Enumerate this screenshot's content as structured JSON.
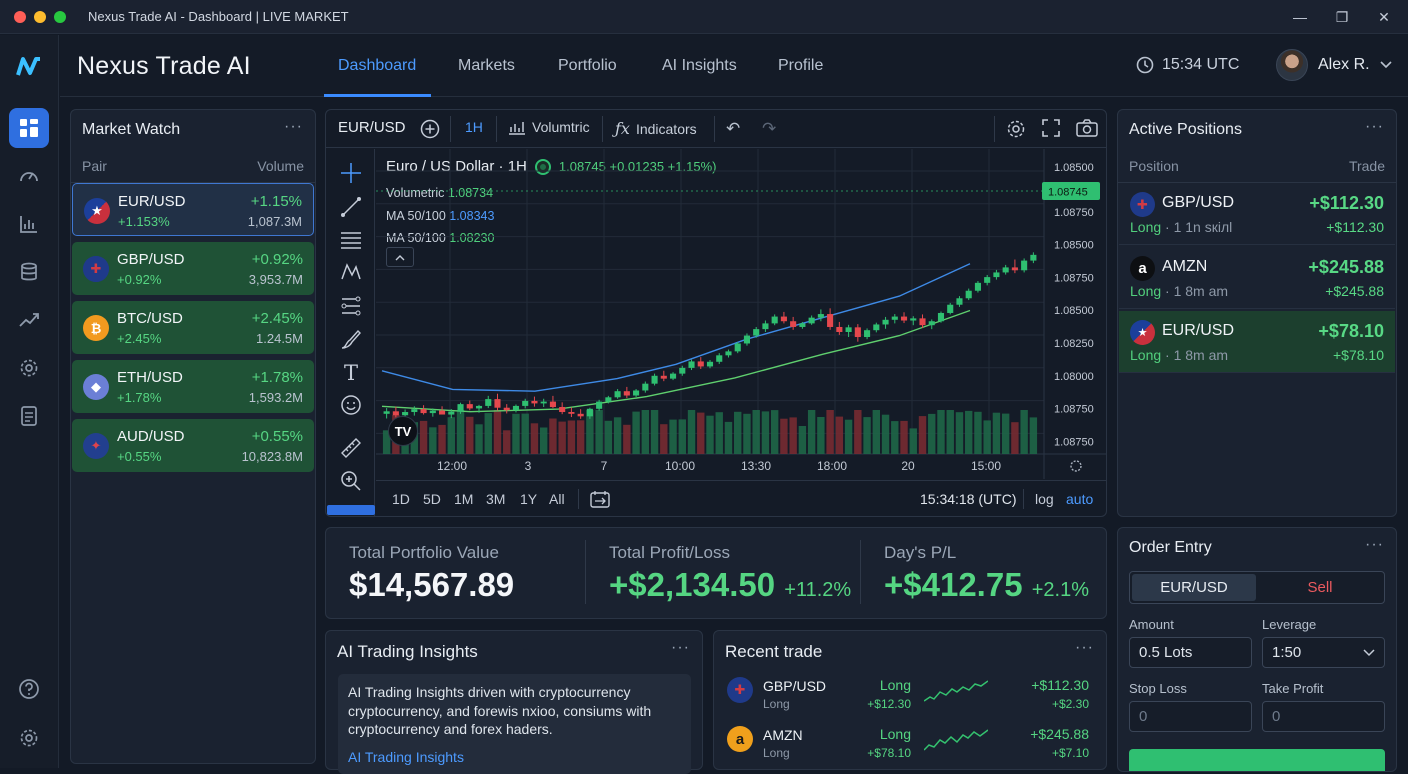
{
  "window": {
    "title": "Nexus Trade AI - Dashboard | LIVE MARKET",
    "minimize": "—",
    "maximize": "❐",
    "close": "✕"
  },
  "brand": {
    "name": "Nexus Trade AI"
  },
  "nav": {
    "tabs": [
      "Dashboard",
      "Markets",
      "Portfolio",
      "AI Insights",
      "Profile"
    ],
    "active": "Dashboard"
  },
  "header": {
    "time": "15:34 UTC",
    "user_name": "Alex R."
  },
  "sidebar_icons": [
    "dashboard-icon",
    "gauge-icon",
    "chart-bars-icon",
    "database-icon",
    "trend-up-icon",
    "gear-icon",
    "report-icon",
    "help-icon",
    "settings-icon"
  ],
  "market_watch": {
    "title": "Market Watch",
    "menu": "···",
    "col_pair": "Pair",
    "col_volume": "Volume",
    "items": [
      {
        "pair": "EUR/USD",
        "sub": "+1.153%",
        "change": "+1.15%",
        "volume": "1,087.3M",
        "icon": "us-eu-flag"
      },
      {
        "pair": "GBP/USD",
        "sub": "+0.92%",
        "change": "+0.92%",
        "volume": "3,953.7M",
        "icon": "uk-flag"
      },
      {
        "pair": "BTC/USD",
        "sub": "+2.45%",
        "change": "+2.45%",
        "volume": "1.24.5M",
        "icon": "bitcoin-icon"
      },
      {
        "pair": "ETH/USD",
        "sub": "+1.78%",
        "change": "+1.78%",
        "volume": "1,593.2M",
        "icon": "ethereum-icon"
      },
      {
        "pair": "AUD/USD",
        "sub": "+0.55%",
        "change": "+0.55%",
        "volume": "10,823.8M",
        "icon": "australia-flag"
      }
    ]
  },
  "chart_toolbar": {
    "symbol": "EUR/USD",
    "interval": "1H",
    "volumetric": "Volumtric",
    "indicators": "Indicators"
  },
  "chart_legend": {
    "title": "Euro / US Dollar · 1H",
    "quote": "1.08745 +0.01235 +1.15%)",
    "volumetric_label": "Volumetric",
    "volumetric_value": "1.08734",
    "ma1_label": "MA 50/100",
    "ma1_value": "1.08343",
    "ma2_label": "MA 50/100",
    "ma2_value": "1.08230"
  },
  "chart_footer": {
    "ranges": [
      "1D",
      "5D",
      "1M",
      "3M",
      "1Y",
      "All"
    ],
    "clock": "15:34:18 (UTC)",
    "log": "log",
    "auto": "auto"
  },
  "chart_data": {
    "type": "candlestick",
    "title": "Euro / US Dollar · 1H",
    "x_ticks": [
      "12:00",
      "3",
      "7",
      "10:00",
      "13:30",
      "18:00",
      "20",
      "15:00"
    ],
    "y_ticks": [
      "1.08500",
      "1.08750",
      "1.08500",
      "1.08750",
      "1.08500",
      "1.08250",
      "1.08000",
      "1.08750",
      "1.08750"
    ],
    "last_price": "1.08745",
    "ylim": [
      1.0795,
      1.088
    ],
    "grid": true,
    "candles": [
      [
        1.08062,
        1.08078,
        1.08049,
        1.08069
      ],
      [
        1.08069,
        1.08082,
        1.08052,
        1.08058
      ],
      [
        1.08058,
        1.08074,
        1.08046,
        1.08067
      ],
      [
        1.08067,
        1.08083,
        1.08057,
        1.08075
      ],
      [
        1.08075,
        1.08086,
        1.0806,
        1.08064
      ],
      [
        1.08064,
        1.08077,
        1.08054,
        1.08071
      ],
      [
        1.08071,
        1.08083,
        1.08061,
        1.0806
      ],
      [
        1.0806,
        1.08075,
        1.0805,
        1.08068
      ],
      [
        1.08068,
        1.08093,
        1.08062,
        1.08089
      ],
      [
        1.08089,
        1.08099,
        1.08072,
        1.08077
      ],
      [
        1.08077,
        1.08087,
        1.08065,
        1.08084
      ],
      [
        1.08084,
        1.08112,
        1.08078,
        1.08103
      ],
      [
        1.08103,
        1.08118,
        1.08071,
        1.08079
      ],
      [
        1.08079,
        1.08089,
        1.08063,
        1.08072
      ],
      [
        1.08072,
        1.08088,
        1.08066,
        1.08084
      ],
      [
        1.08084,
        1.08104,
        1.08077,
        1.08098
      ],
      [
        1.08098,
        1.0811,
        1.08082,
        1.08091
      ],
      [
        1.08091,
        1.08104,
        1.08081,
        1.08096
      ],
      [
        1.08096,
        1.08112,
        1.08078,
        1.08081
      ],
      [
        1.08081,
        1.08094,
        1.08061,
        1.08067
      ],
      [
        1.08067,
        1.0808,
        1.08053,
        1.08062
      ],
      [
        1.08062,
        1.08075,
        1.08048,
        1.08055
      ],
      [
        1.08055,
        1.08079,
        1.08048,
        1.08076
      ],
      [
        1.08076,
        1.08101,
        1.08071,
        1.08096
      ],
      [
        1.08096,
        1.08112,
        1.08091,
        1.08108
      ],
      [
        1.08108,
        1.08131,
        1.08104,
        1.08125
      ],
      [
        1.08125,
        1.08137,
        1.08106,
        1.08113
      ],
      [
        1.08113,
        1.08131,
        1.08109,
        1.08127
      ],
      [
        1.08127,
        1.08152,
        1.08121,
        1.08146
      ],
      [
        1.08146,
        1.08174,
        1.08141,
        1.08168
      ],
      [
        1.08168,
        1.08182,
        1.08153,
        1.0816
      ],
      [
        1.0816,
        1.08178,
        1.08156,
        1.08174
      ],
      [
        1.08174,
        1.08196,
        1.08168,
        1.0819
      ],
      [
        1.0819,
        1.08213,
        1.08184,
        1.08208
      ],
      [
        1.08208,
        1.0822,
        1.08187,
        1.08194
      ],
      [
        1.08194,
        1.08212,
        1.08189,
        1.08207
      ],
      [
        1.08207,
        1.08231,
        1.08201,
        1.08225
      ],
      [
        1.08225,
        1.08241,
        1.08219,
        1.08236
      ],
      [
        1.08236,
        1.08262,
        1.08231,
        1.08258
      ],
      [
        1.08258,
        1.08286,
        1.08252,
        1.0828
      ],
      [
        1.0828,
        1.08304,
        1.08274,
        1.08298
      ],
      [
        1.08298,
        1.08322,
        1.0829,
        1.08314
      ],
      [
        1.08314,
        1.08339,
        1.08309,
        1.08333
      ],
      [
        1.08333,
        1.08346,
        1.08314,
        1.0832
      ],
      [
        1.0832,
        1.08332,
        1.08296,
        1.08304
      ],
      [
        1.08304,
        1.08318,
        1.08299,
        1.08314
      ],
      [
        1.08314,
        1.08336,
        1.0831,
        1.0833
      ],
      [
        1.0833,
        1.08353,
        1.0832,
        1.0834
      ],
      [
        1.0834,
        1.08356,
        1.08296,
        1.08304
      ],
      [
        1.08304,
        1.08318,
        1.08282,
        1.0829
      ],
      [
        1.0829,
        1.0831,
        1.08276,
        1.08303
      ],
      [
        1.08303,
        1.08312,
        1.08263,
        1.08276
      ],
      [
        1.08276,
        1.083,
        1.0827,
        1.08295
      ],
      [
        1.08295,
        1.08316,
        1.08289,
        1.08311
      ],
      [
        1.08311,
        1.08332,
        1.08299,
        1.08324
      ],
      [
        1.08324,
        1.0834,
        1.08314,
        1.08333
      ],
      [
        1.08333,
        1.08345,
        1.08315,
        1.08322
      ],
      [
        1.08322,
        1.08334,
        1.08309,
        1.08328
      ],
      [
        1.08328,
        1.08339,
        1.08301,
        1.08309
      ],
      [
        1.08309,
        1.08325,
        1.08298,
        1.0832
      ],
      [
        1.0832,
        1.08347,
        1.08316,
        1.08343
      ],
      [
        1.08343,
        1.08371,
        1.08339,
        1.08366
      ],
      [
        1.08366,
        1.0839,
        1.0836,
        1.08384
      ],
      [
        1.08384,
        1.08411,
        1.08379,
        1.08405
      ],
      [
        1.08405,
        1.08432,
        1.084,
        1.08427
      ],
      [
        1.08427,
        1.08449,
        1.0842,
        1.08443
      ],
      [
        1.08443,
        1.08463,
        1.08436,
        1.08456
      ],
      [
        1.08456,
        1.08477,
        1.0845,
        1.0847
      ],
      [
        1.0847,
        1.08492,
        1.08454,
        1.08462
      ],
      [
        1.08462,
        1.08495,
        1.08456,
        1.08489
      ],
      [
        1.08489,
        1.08512,
        1.08482,
        1.08505
      ]
    ],
    "ma_fast": [
      [
        0,
        1.08182
      ],
      [
        0.12,
        1.0813
      ],
      [
        0.26,
        1.08125
      ],
      [
        0.4,
        1.0816
      ],
      [
        0.5,
        1.082
      ],
      [
        0.62,
        1.0827
      ],
      [
        0.75,
        1.0833
      ],
      [
        0.88,
        1.0839
      ],
      [
        1,
        1.0848
      ]
    ],
    "ma_slow": [
      [
        0,
        1.08083
      ],
      [
        0.15,
        1.08068
      ],
      [
        0.3,
        1.08075
      ],
      [
        0.45,
        1.0811
      ],
      [
        0.6,
        1.08162
      ],
      [
        0.75,
        1.08228
      ],
      [
        0.88,
        1.0828
      ],
      [
        1,
        1.0835
      ]
    ]
  },
  "stats": {
    "total_label": "Total Portfolio Value",
    "total_value": "$14,567.89",
    "pl_label": "Total Profit/Loss",
    "pl_value": "+$2,134.50",
    "pl_pct": "+11.2%",
    "day_label": "Day's P/L",
    "day_value": "+$412.75",
    "day_pct": "+2.1%"
  },
  "ai_insights": {
    "title": "AI Trading Insights",
    "menu": "···",
    "body": "AI Trading Insights driven with cryptocurrency cryptocurrency, and forewis nxioo, consiums with cryptocurrency and forex haders.",
    "link": "AI Trading Insights"
  },
  "recent_trade": {
    "title": "Recent trade",
    "menu": "···",
    "rows": [
      {
        "pair": "GBP/USD",
        "sub": "Long",
        "dir": "Long",
        "dir_val": "+$12.30",
        "pnl": "+$112.30",
        "pnl_sub": "+$2.30",
        "icon": "uk-flag"
      },
      {
        "pair": "AMZN",
        "sub": "Long",
        "dir": "Long",
        "dir_val": "+$78.10",
        "pnl": "+$245.88",
        "pnl_sub": "+$7.10",
        "icon": "amazon-logo"
      }
    ]
  },
  "active_positions": {
    "title": "Active Positions",
    "menu": "···",
    "col_position": "Position",
    "col_trade": "Trade",
    "rows": [
      {
        "pair": "GBP/USD",
        "side": "Long",
        "meta": "· 1 1n sкiлl",
        "pnl": "+$112.30",
        "pnl_sub": "+$112.30",
        "icon": "uk-flag"
      },
      {
        "pair": "AMZN",
        "side": "Long",
        "meta": "· 1 8m am",
        "pnl": "+$245.88",
        "pnl_sub": "+$245.88",
        "icon": "amazon-logo"
      },
      {
        "pair": "EUR/USD",
        "side": "Long",
        "meta": "· 1 8m am",
        "pnl": "+$78.10",
        "pnl_sub": "+$78.10",
        "icon": "eu-flag"
      }
    ]
  },
  "order_entry": {
    "title": "Order Entry",
    "menu": "···",
    "pair_tab": "EUR/USD",
    "sell_tab": "Sell",
    "amount_label": "Amount",
    "amount_value": "0.5 Lots",
    "leverage_label": "Leverage",
    "leverage_value": "1:50",
    "stop_label": "Stop Loss",
    "stop_placeholder": "0",
    "take_label": "Take Profit",
    "take_placeholder": "0"
  },
  "colors": {
    "accent": "#3a8bff",
    "up": "#2fbf71",
    "down": "#e5484d",
    "panel": "#1a2230",
    "bg": "#131a26"
  }
}
